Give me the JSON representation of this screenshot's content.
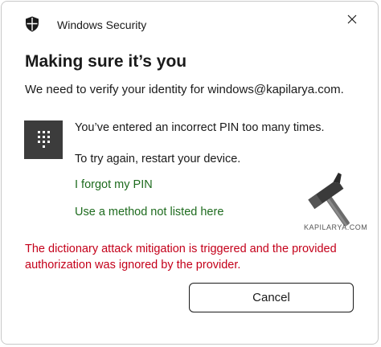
{
  "window": {
    "app_title": "Windows Security",
    "close_glyph": "✕"
  },
  "dialog": {
    "heading": "Making sure it’s you",
    "subtitle": "We need to verify your identity for windows@kapilarya.com.",
    "message_line1": "You’ve entered an incorrect PIN too many times.",
    "message_line2": "To try again, restart your device.",
    "links": [
      {
        "label": "I forgot my PIN"
      },
      {
        "label": "Use a method not listed here"
      }
    ],
    "error_text": "The dictionary attack mitigation is triggered and the provided authorization was ignored by the provider.",
    "cancel_label": "Cancel"
  },
  "watermark": {
    "text": "KAPILARYA.COM"
  },
  "colors": {
    "link": "#1e6b1e",
    "error": "#c4001a",
    "pin_tile": "#3c3c3c"
  },
  "icons": {
    "app": "shield-icon",
    "close": "close-icon",
    "pin": "pin-keypad-icon",
    "watermark": "hammer-icon"
  }
}
